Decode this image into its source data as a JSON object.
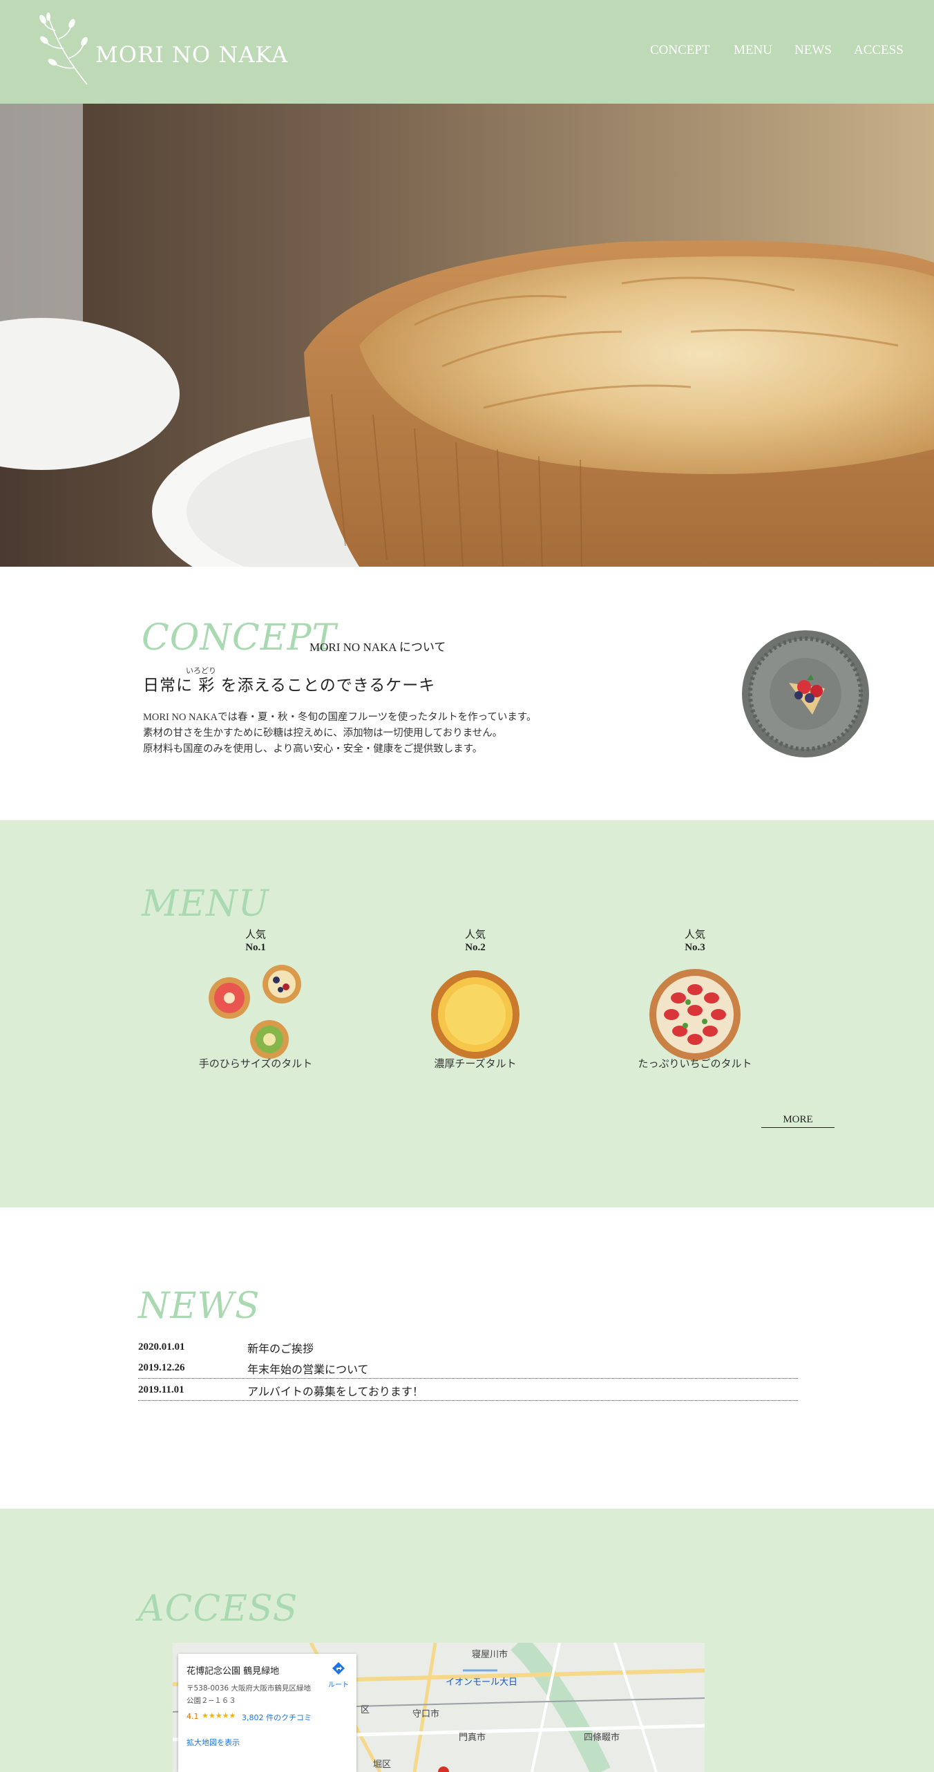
{
  "header": {
    "logo_text": "MORI NO NAKA",
    "nav": [
      "CONCEPT",
      "MENU",
      "NEWS",
      "ACCESS"
    ]
  },
  "concept": {
    "title": "CONCEPT",
    "subtitle": "MORI NO NAKA について",
    "ruby": "いろどり",
    "heading": "日常に 彩 を添えることのできるケーキ",
    "body": [
      "MORI NO NAKAでは春・夏・秋・冬旬の国産フルーツを使ったタルトを作っています。",
      "素材の甘さを生かすために砂糖は控えめに、添加物は一切使用しておりません。",
      "原材料も国産のみを使用し、より高い安心・安全・健康をご提供致します。"
    ]
  },
  "menu": {
    "title": "MENU",
    "items": [
      {
        "rank_label": "人気",
        "rank": "No.1",
        "name": "手のひらサイズのタルト"
      },
      {
        "rank_label": "人気",
        "rank": "No.2",
        "name": "濃厚チーズタルト"
      },
      {
        "rank_label": "人気",
        "rank": "No.3",
        "name": "たっぷりいちごのタルト"
      }
    ],
    "more": "MORE"
  },
  "news": {
    "title": "NEWS",
    "items": [
      {
        "date": "2020.01.01",
        "text": "新年のご挨拶"
      },
      {
        "date": "2019.12.26",
        "text": "年末年始の営業について"
      },
      {
        "date": "2019.11.01",
        "text": "アルバイトの募集をしております！"
      }
    ]
  },
  "access": {
    "title": "ACCESS",
    "map": {
      "place_name": "花博記念公園 鶴見緑地",
      "address_line1": "〒538-0036 大阪府大阪市鶴見区緑地",
      "address_line2": "公園２−１６３",
      "rating": "4.1",
      "stars": "★★★★★",
      "reviews": "3,802 件のクチコミ",
      "directions_label": "ルート",
      "enlarge_link": "拡大地図を表示",
      "labels": [
        "寝屋川市",
        "イオンモール大日",
        "守口市",
        "門真市",
        "四條畷市",
        "区",
        "堀区"
      ]
    }
  },
  "colors": {
    "header_bg": "#bed9b6",
    "section_bg": "#dbeed5",
    "script_title": "#a9d9b0"
  }
}
